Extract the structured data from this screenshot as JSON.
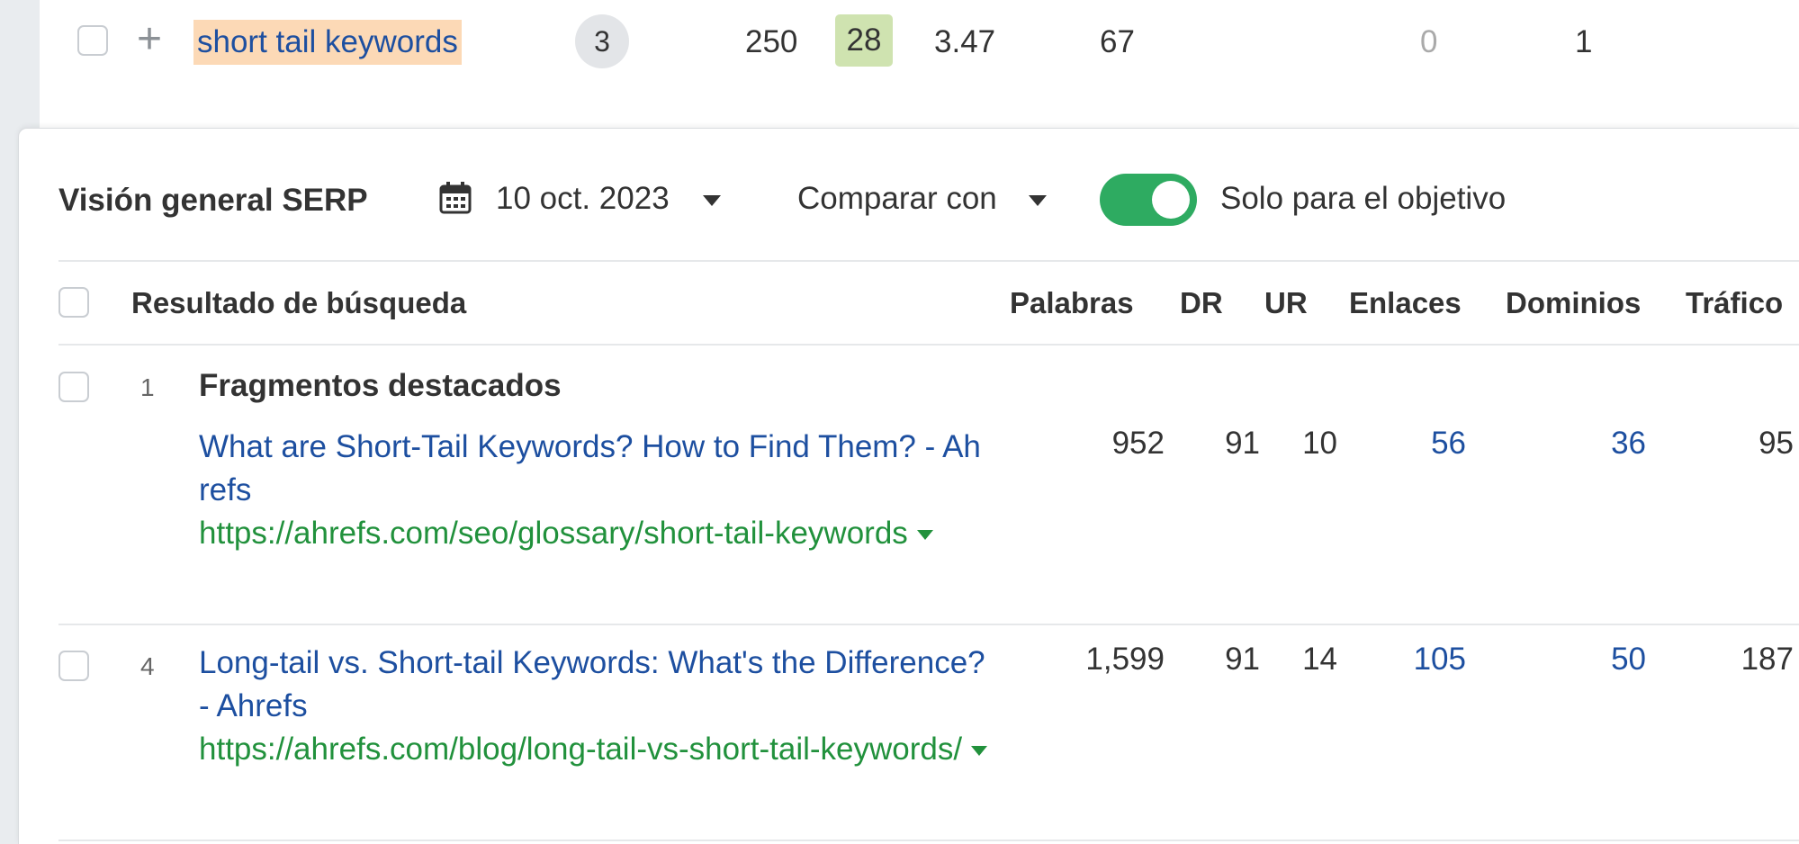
{
  "keyword_row": {
    "keyword": "short tail keywords",
    "parent_topic_count": "3",
    "volume": "250",
    "kd": "28",
    "cpc": "3.47",
    "traffic_potential": "67",
    "col_a": "0",
    "col_b": "1"
  },
  "serp_panel": {
    "title": "Visión general SERP",
    "date": "10 oct. 2023",
    "compare_label": "Comparar con",
    "toggle_on": true,
    "toggle_label": "Solo para el objetivo",
    "columns": [
      "Resultado de búsqueda",
      "Palabras",
      "DR",
      "UR",
      "Enlaces",
      "Dominios",
      "Tráfico"
    ],
    "rows": [
      {
        "position": "1",
        "feature": "Fragmentos destacados",
        "title": "What are Short-Tail Keywords? How to Find Them? - Ahrefs",
        "url": "https://ahrefs.com/seo/glossary/short-tail-keywords",
        "words": "952",
        "dr": "91",
        "ur": "10",
        "links": "56",
        "domains": "36",
        "traffic": "95"
      },
      {
        "position": "4",
        "title": "Long-tail vs. Short-tail Keywords: What's the Difference? - Ahrefs",
        "url": "https://ahrefs.com/blog/long-tail-vs-short-tail-keywords/",
        "words": "1,599",
        "dr": "91",
        "ur": "14",
        "links": "105",
        "domains": "50",
        "traffic": "187"
      }
    ]
  },
  "colors": {
    "link_blue": "#1d4fa0",
    "url_green": "#21913c",
    "toggle_green": "#2eab61",
    "keyword_highlight": "#fcd9b6",
    "kd_badge": "#cfe3b0"
  },
  "icons": [
    "checkbox",
    "plus-icon",
    "calendar-icon",
    "caret-down-icon",
    "toggle-switch"
  ]
}
